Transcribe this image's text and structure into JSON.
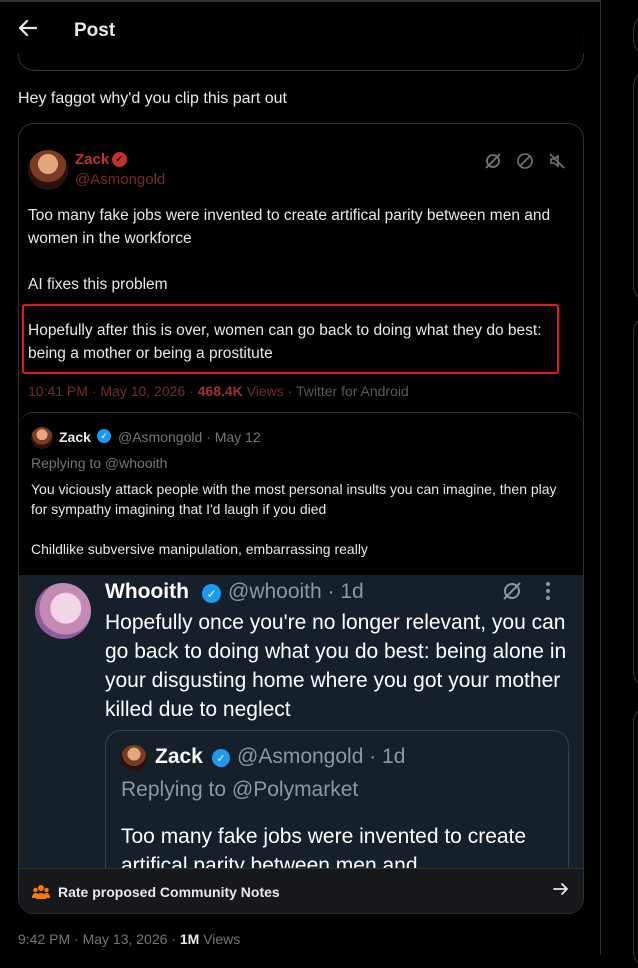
{
  "header": {
    "back_icon": "arrow-left-icon",
    "title": "Post"
  },
  "post": {
    "text": "Hey faggot why'd you clip this part out",
    "time": "9:42 PM · May 13, 2026 · ",
    "views_count": "1M",
    "views_label": " Views"
  },
  "embed": {
    "tweet1": {
      "name": "Zack",
      "handle": "@Asmongold",
      "icons": [
        "grok-icon",
        "block-icon",
        "mute-icon",
        "more-icon"
      ],
      "para1": "Too many fake jobs were invented to create artifical parity between men and women in the workforce",
      "para2": "AI fixes this problem",
      "para3": "Hopefully after this is over, women can go back to doing what they do best: being a mother or being a prostitute",
      "time": "10:41 PM · May 10, 2026 · ",
      "views_count": "468.4K",
      "views_label": " Views",
      "source": " · Twitter for Android",
      "highlight_color": "#e41a1a"
    },
    "reply": {
      "name": "Zack",
      "handle": "@Asmongold · May 12",
      "replying": "Replying to @whooith",
      "para1": "You viciously attack people with the most personal insults you can imagine, then play for sympathy imagining that I'd laugh if you died",
      "para2": "Childlike subversive manipulation, embarrassing really"
    },
    "whooith": {
      "name": "Whooith",
      "handle": "@whooith · 1d",
      "text": "Hopefully once you're no longer relevant, you can go back to doing what you do best: being alone in your disgusting home where you got your mother killed due to neglect",
      "icons": [
        "grok-icon",
        "more-vertical-icon"
      ],
      "quote": {
        "name": "Zack",
        "handle": "@Asmongold · 1d",
        "replying": "Replying to @Polymarket",
        "text": "Too many fake jobs were invented to create artifical parity between men and"
      }
    },
    "community_notes": {
      "icon": "people-icon",
      "label": "Rate proposed Community Notes",
      "arrow": "arrow-right-icon"
    }
  },
  "colors": {
    "background": "#000000",
    "dim_background": "#15202b",
    "verified": "#1d9bf0",
    "zack_red": "#c4302b"
  }
}
